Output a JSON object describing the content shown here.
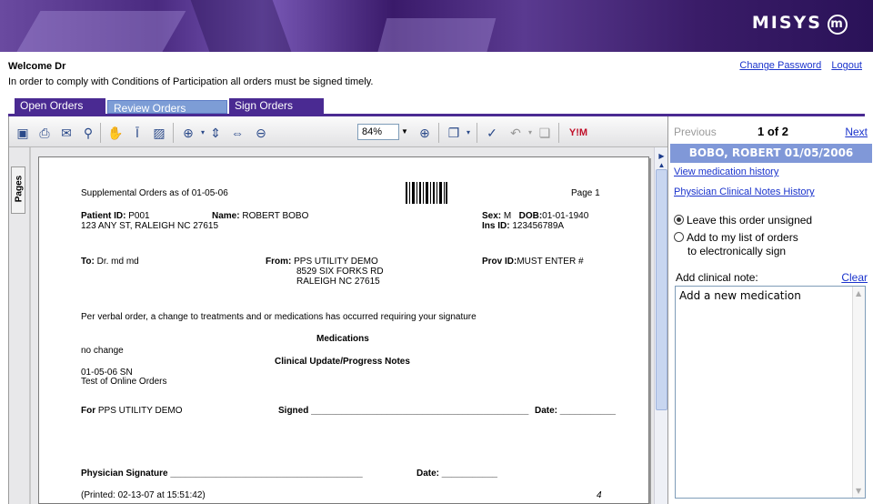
{
  "brand": {
    "logo_text": "MISYS",
    "logo_mark": "m"
  },
  "header": {
    "welcome": "Welcome Dr",
    "notice": "In order to comply with Conditions of Participation all orders must be signed timely.",
    "change_password": "Change Password",
    "logout": "Logout"
  },
  "tabs": [
    {
      "label": "Open Orders"
    },
    {
      "label": "Review Orders"
    },
    {
      "label": "Sign Orders"
    }
  ],
  "toolbar": {
    "zoom_value": "84%",
    "yim_label": "Y!M"
  },
  "sidebar": {
    "pages_label": "Pages"
  },
  "document": {
    "title": "Supplemental Orders as of 01-05-06",
    "page": "Page 1",
    "patient_id_label": "Patient ID:",
    "patient_id": "P001",
    "name_label": "Name:",
    "name": "ROBERT BOBO",
    "address": "123 ANY ST, RALEIGH NC 27615",
    "sex_label": "Sex:",
    "sex": "M",
    "dob_label": "DOB:",
    "dob": "01-01-1940",
    "ins_label": "Ins ID:",
    "ins_id": "123456789A",
    "to_label": "To:",
    "to": "Dr. md md",
    "from_label": "From:",
    "from_line1": "PPS UTILITY DEMO",
    "from_line2": "8529 SIX FORKS RD",
    "from_line3": "RALEIGH NC 27615",
    "prov_label": "Prov ID:",
    "prov_id": "MUST ENTER #",
    "verbal_order": "Per verbal order, a change to treatments and or medications has occurred requiring your signature",
    "medications_heading": "Medications",
    "med_text": "no change",
    "clinical_heading": "Clinical Update/Progress Notes",
    "clinical_line1": "01-05-06 SN",
    "clinical_line2": "Test of Online Orders",
    "for_label": "For",
    "for_value": "PPS UTILITY DEMO",
    "signed_label": "Signed ___________________________________________",
    "date_label": "Date: ___________",
    "physician_signature": "Physician Signature ______________________________________",
    "date_label2": "Date: ___________",
    "printed": "(Printed: 02-13-07 at 15:51:42)",
    "footer_num": "4"
  },
  "review": {
    "previous": "Previous",
    "count": "1 of 2",
    "next": "Next",
    "patient_bar": "BOBO, ROBERT 01/05/2006",
    "link_history": "View medication history",
    "link_notes": "Physician Clinical Notes History",
    "radio_unsigned": "Leave this order unsigned",
    "radio_add_line1": "Add to my list of orders",
    "radio_add_line2": "to electronically sign",
    "note_label": "Add clinical note:",
    "clear": "Clear",
    "note_value": "Add a new medication"
  }
}
